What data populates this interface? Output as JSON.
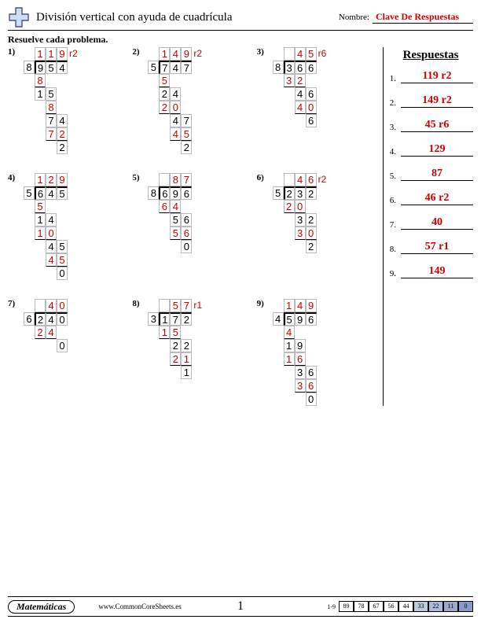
{
  "header": {
    "title": "División vertical con ayuda de cuadrícula",
    "name_label": "Nombre:",
    "name_value": "Clave De Respuestas"
  },
  "instructions": "Resuelve cada problema.",
  "answers_title": "Respuestas",
  "answers": [
    "119 r2",
    "149 r2",
    "45 r6",
    "129",
    "87",
    "46 r2",
    "40",
    "57 r1",
    "149"
  ],
  "footer": {
    "subject": "Matemáticas",
    "site": "www.CommonCoreSheets.es",
    "page": "1",
    "score_label": "1-9",
    "scores": [
      "89",
      "78",
      "67",
      "56",
      "44",
      "33",
      "22",
      "11",
      "0"
    ]
  },
  "problems": [
    {
      "n": "1)",
      "divisor": "8",
      "dividend": [
        "9",
        "5",
        "4"
      ],
      "quotient": [
        "1",
        "1",
        "9"
      ],
      "rem": "r2",
      "rows": [
        {
          "off": 0,
          "cells": [
            "8"
          ],
          "cls": [
            "red"
          ],
          "bb": true
        },
        {
          "off": 0,
          "cells": [
            "1",
            "5"
          ],
          "cls": [
            "blk",
            "blk"
          ]
        },
        {
          "off": 1,
          "cells": [
            "8"
          ],
          "cls": [
            "red"
          ],
          "bb": true
        },
        {
          "off": 1,
          "cells": [
            "7",
            "4"
          ],
          "cls": [
            "blk",
            "blk"
          ]
        },
        {
          "off": 1,
          "cells": [
            "7",
            "2"
          ],
          "cls": [
            "red",
            "red"
          ],
          "bb": true
        },
        {
          "off": 2,
          "cells": [
            "2"
          ],
          "cls": [
            "blk"
          ]
        }
      ]
    },
    {
      "n": "2)",
      "divisor": "5",
      "dividend": [
        "7",
        "4",
        "7"
      ],
      "quotient": [
        "1",
        "4",
        "9"
      ],
      "rem": "r2",
      "rows": [
        {
          "off": 0,
          "cells": [
            "5"
          ],
          "cls": [
            "red"
          ],
          "bb": true
        },
        {
          "off": 0,
          "cells": [
            "2",
            "4"
          ],
          "cls": [
            "blk",
            "blk"
          ]
        },
        {
          "off": 0,
          "cells": [
            "2",
            "0"
          ],
          "cls": [
            "red",
            "red"
          ],
          "bb": true
        },
        {
          "off": 1,
          "cells": [
            "4",
            "7"
          ],
          "cls": [
            "blk",
            "blk"
          ]
        },
        {
          "off": 1,
          "cells": [
            "4",
            "5"
          ],
          "cls": [
            "red",
            "red"
          ],
          "bb": true
        },
        {
          "off": 2,
          "cells": [
            "2"
          ],
          "cls": [
            "blk"
          ]
        }
      ]
    },
    {
      "n": "3)",
      "divisor": "8",
      "dividend": [
        "3",
        "6",
        "6"
      ],
      "quotient": [
        "",
        "4",
        "5"
      ],
      "rem": "r6",
      "rows": [
        {
          "off": 0,
          "cells": [
            "3",
            "2"
          ],
          "cls": [
            "red",
            "red"
          ],
          "bb": true
        },
        {
          "off": 1,
          "cells": [
            "4",
            "6"
          ],
          "cls": [
            "blk",
            "blk"
          ]
        },
        {
          "off": 1,
          "cells": [
            "4",
            "0"
          ],
          "cls": [
            "red",
            "red"
          ],
          "bb": true
        },
        {
          "off": 2,
          "cells": [
            "6"
          ],
          "cls": [
            "blk"
          ]
        }
      ]
    },
    {
      "n": "4)",
      "divisor": "5",
      "dividend": [
        "6",
        "4",
        "5"
      ],
      "quotient": [
        "1",
        "2",
        "9"
      ],
      "rem": "",
      "rows": [
        {
          "off": 0,
          "cells": [
            "5"
          ],
          "cls": [
            "red"
          ],
          "bb": true
        },
        {
          "off": 0,
          "cells": [
            "1",
            "4"
          ],
          "cls": [
            "blk",
            "blk"
          ]
        },
        {
          "off": 0,
          "cells": [
            "1",
            "0"
          ],
          "cls": [
            "red",
            "red"
          ],
          "bb": true
        },
        {
          "off": 1,
          "cells": [
            "4",
            "5"
          ],
          "cls": [
            "blk",
            "blk"
          ]
        },
        {
          "off": 1,
          "cells": [
            "4",
            "5"
          ],
          "cls": [
            "red",
            "red"
          ],
          "bb": true
        },
        {
          "off": 2,
          "cells": [
            "0"
          ],
          "cls": [
            "blk"
          ]
        }
      ]
    },
    {
      "n": "5)",
      "divisor": "8",
      "dividend": [
        "6",
        "9",
        "6"
      ],
      "quotient": [
        "",
        "8",
        "7"
      ],
      "rem": "",
      "rows": [
        {
          "off": 0,
          "cells": [
            "6",
            "4"
          ],
          "cls": [
            "red",
            "red"
          ],
          "bb": true
        },
        {
          "off": 1,
          "cells": [
            "5",
            "6"
          ],
          "cls": [
            "blk",
            "blk"
          ]
        },
        {
          "off": 1,
          "cells": [
            "5",
            "6"
          ],
          "cls": [
            "red",
            "red"
          ],
          "bb": true
        },
        {
          "off": 2,
          "cells": [
            "0"
          ],
          "cls": [
            "blk"
          ]
        }
      ]
    },
    {
      "n": "6)",
      "divisor": "5",
      "dividend": [
        "2",
        "3",
        "2"
      ],
      "quotient": [
        "",
        "4",
        "6"
      ],
      "rem": "r2",
      "rows": [
        {
          "off": 0,
          "cells": [
            "2",
            "0"
          ],
          "cls": [
            "red",
            "red"
          ],
          "bb": true
        },
        {
          "off": 1,
          "cells": [
            "3",
            "2"
          ],
          "cls": [
            "blk",
            "blk"
          ]
        },
        {
          "off": 1,
          "cells": [
            "3",
            "0"
          ],
          "cls": [
            "red",
            "red"
          ],
          "bb": true
        },
        {
          "off": 2,
          "cells": [
            "2"
          ],
          "cls": [
            "blk"
          ]
        }
      ]
    },
    {
      "n": "7)",
      "divisor": "6",
      "dividend": [
        "2",
        "4",
        "0"
      ],
      "quotient": [
        "",
        "4",
        "0"
      ],
      "rem": "",
      "rows": [
        {
          "off": 0,
          "cells": [
            "2",
            "4"
          ],
          "cls": [
            "red",
            "red"
          ],
          "bb": true
        },
        {
          "off": 2,
          "cells": [
            "0"
          ],
          "cls": [
            "blk"
          ]
        }
      ]
    },
    {
      "n": "8)",
      "divisor": "3",
      "dividend": [
        "1",
        "7",
        "2"
      ],
      "quotient": [
        "",
        "5",
        "7"
      ],
      "rem": "r1",
      "rows": [
        {
          "off": 0,
          "cells": [
            "1",
            "5"
          ],
          "cls": [
            "red",
            "red"
          ],
          "bb": true
        },
        {
          "off": 1,
          "cells": [
            "2",
            "2"
          ],
          "cls": [
            "blk",
            "blk"
          ]
        },
        {
          "off": 1,
          "cells": [
            "2",
            "1"
          ],
          "cls": [
            "red",
            "red"
          ],
          "bb": true
        },
        {
          "off": 2,
          "cells": [
            "1"
          ],
          "cls": [
            "blk"
          ]
        }
      ]
    },
    {
      "n": "9)",
      "divisor": "4",
      "dividend": [
        "5",
        "9",
        "6"
      ],
      "quotient": [
        "1",
        "4",
        "9"
      ],
      "rem": "",
      "rows": [
        {
          "off": 0,
          "cells": [
            "4"
          ],
          "cls": [
            "red"
          ],
          "bb": true
        },
        {
          "off": 0,
          "cells": [
            "1",
            "9"
          ],
          "cls": [
            "blk",
            "blk"
          ]
        },
        {
          "off": 0,
          "cells": [
            "1",
            "6"
          ],
          "cls": [
            "red",
            "red"
          ],
          "bb": true
        },
        {
          "off": 1,
          "cells": [
            "3",
            "6"
          ],
          "cls": [
            "blk",
            "blk"
          ]
        },
        {
          "off": 1,
          "cells": [
            "3",
            "6"
          ],
          "cls": [
            "red",
            "red"
          ],
          "bb": true
        },
        {
          "off": 2,
          "cells": [
            "0"
          ],
          "cls": [
            "blk"
          ]
        }
      ]
    }
  ]
}
